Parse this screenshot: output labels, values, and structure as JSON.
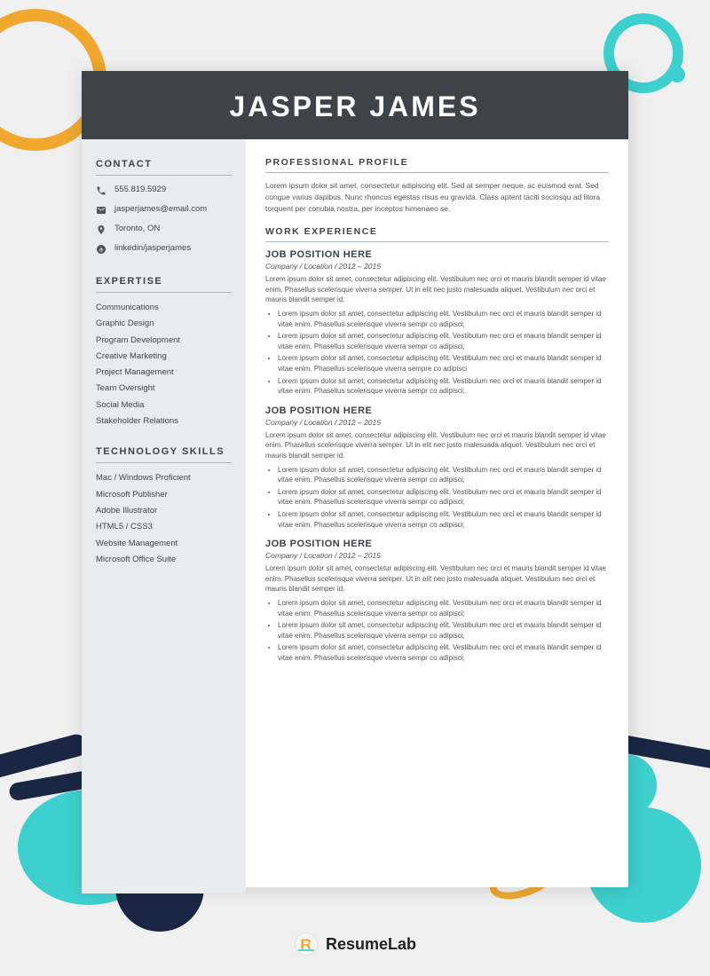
{
  "background": {
    "colors": {
      "header_bg": "#3d4348",
      "sidebar_bg": "#e8ecee",
      "accent_teal": "#3ecfcf",
      "accent_orange": "#f0a830",
      "accent_navy": "#1a2744"
    }
  },
  "header": {
    "name": "JASPER JAMES"
  },
  "sidebar": {
    "contact": {
      "title": "CONTACT",
      "items": [
        {
          "icon": "phone-icon",
          "text": "555.819.5929"
        },
        {
          "icon": "email-icon",
          "text": "jasperjames@email.com"
        },
        {
          "icon": "location-icon",
          "text": "Toronto, ON"
        },
        {
          "icon": "linkedin-icon",
          "text": "linkedin/jasperjames"
        }
      ]
    },
    "expertise": {
      "title": "EXPERTISE",
      "items": [
        "Communications",
        "Graphic Design",
        "Program Development",
        "Creative Marketing",
        "Project Management",
        "Team Oversight",
        "Social Media",
        "Stakeholder Relations"
      ]
    },
    "technology": {
      "title": "TECHNOLOGY SKILLS",
      "items": [
        "Mac / Windows Proficient",
        "Microsoft Publisher",
        "Adobe Illustrator",
        "HTML5 / CSS3",
        "Website Management",
        "Microsoft Office Suite"
      ]
    }
  },
  "main": {
    "profile": {
      "title": "PROFESSIONAL PROFILE",
      "text": "Lorem ipsum dolor sit amet, consectetur adipiscing elit. Sed at semper neque, ac euismod erat. Sed congue varius dapibus. Nunc rhoncus egestas risus eu gravida. Class aptent taciti sociosqu ad litora torquent per conubia nostra, per inceptos himenaeo se."
    },
    "work_experience": {
      "title": "WORK EXPERIENCE",
      "jobs": [
        {
          "title": "JOB POSITION HERE",
          "company": "Company / Location / 2012 – 2015",
          "desc": "Lorem ipsum dolor sit amet, consectetur adipiscing elit. Vestibulum nec orci et mauris blandit semper id vitae enim. Phasellus scelerisque viverra semper. Ut in elit nec justo malesuada aliquet. Vestibulum nec orci et mauris blandit semper id.",
          "bullets": [
            "Lorem ipsum dolor sit amet, consectetur adipiscing elit. Vestibulum nec orci et mauris blandit semper id vitae enim. Phasellus scelerisque viverra sempr co adipisci;",
            "Lorem ipsum dolor sit amet, consectetur adipiscing elit. Vestibulum nec orci et mauris blandit semper id vitae enim. Phasellus scelerisque viverra sempr co adipisci;",
            "Lorem ipsum dolor sit amet, consectetur adipiscing elit. Vestibulum nec orci et mauris blandit semper id vitae enim. Phasellus scelerisque viverra sempre co adipisci",
            "Lorem ipsum dolor sit amet, consectetur adipiscing elit. Vestibulum nec orci et mauris blandit semper id vitae enim. Phasellus scelerisque viverra sempr co adipisci;."
          ]
        },
        {
          "title": "JOB POSITION HERE",
          "company": "Company / Location /  2012 – 2015",
          "desc": "Lorem ipsum dolor sit amet, consectetur adipiscing elit. Vestibulum nec orci et mauris blandit semper id vitae enim. Phasellus scelerisque viverra semper. Ut in elit nec justo malesuada aliquet. Vestibulum nec orci et mauris blandit semper id.",
          "bullets": [
            "Lorem ipsum dolor sit amet, consectetur adipiscing elit. Vestibulum nec orci et mauris blandit semper id vitae enim. Phasellus scelerisque viverra sempr co adipisci;",
            "Lorem ipsum dolor sit amet, consectetur adipiscing elit. Vestibulum nec orci et mauris blandit semper id vitae enim. Phasellus scelerisque viverra sempr co adipisci;",
            "Lorem ipsum dolor sit amet, consectetur adipiscing elit. Vestibulum nec orci et mauris blandit semper id vitae enim. Phasellus scelerisque viverra sempr co adipisci;"
          ]
        },
        {
          "title": "JOB POSITION HERE",
          "company": "Company / Location /  2012 – 2015",
          "desc": "Lorem ipsum dolor sit amet, consectetur adipiscing elit. Vestibulum nec orci et mauris blandit semper id vitae enim. Phasellus scelerisque viverra semper. Ut in elit nec justo malesuada aliquet. Vestibulum nec orci et mauris blandit semper id.",
          "bullets": [
            "Lorem ipsum dolor sit amet, consectetur adipiscing elit. Vestibulum nec orci et mauris blandit semper id vitae enim. Phasellus scelerisque viverra sempr co adipisci;",
            "Lorem ipsum dolor sit amet, consectetur adipiscing elit. Vestibulum nec orci et mauris blandit semper id vitae enim. Phasellus scelerisque viverra sempr co adipisci;",
            "Lorem ipsum dolor sit amet, consectetur adipiscing elit. Vestibulum nec orci et mauris blandit semper id vitae enim. Phasellus scelerisque viverra sempr co adipisci;"
          ]
        }
      ]
    }
  },
  "branding": {
    "logo_alt": "ResumeLab logo",
    "name_plain": "Resume",
    "name_bold": "Lab"
  }
}
